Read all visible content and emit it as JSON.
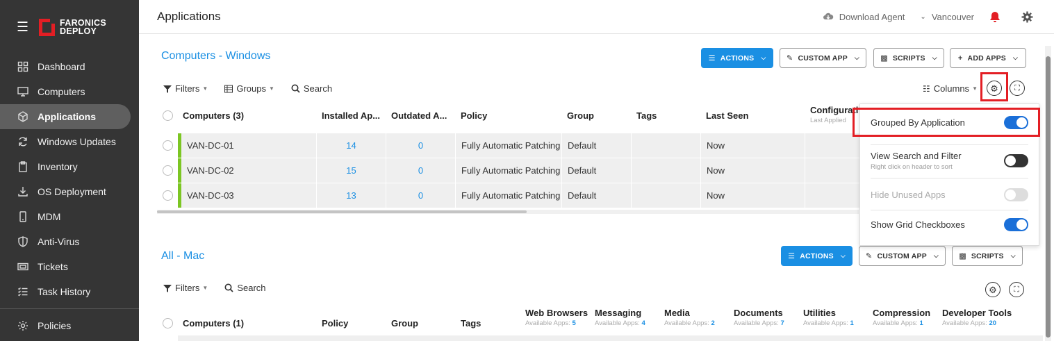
{
  "brand": {
    "line1": "FARONICS",
    "line2": "DEPLOY"
  },
  "nav": [
    {
      "label": "Dashboard",
      "icon": "dashboard-icon"
    },
    {
      "label": "Computers",
      "icon": "monitor-icon"
    },
    {
      "label": "Applications",
      "icon": "cube-icon",
      "active": true
    },
    {
      "label": "Windows Updates",
      "icon": "refresh-icon"
    },
    {
      "label": "Inventory",
      "icon": "clipboard-icon"
    },
    {
      "label": "OS Deployment",
      "icon": "download-icon"
    },
    {
      "label": "MDM",
      "icon": "phone-icon"
    },
    {
      "label": "Anti-Virus",
      "icon": "shield-icon"
    },
    {
      "label": "Tickets",
      "icon": "ticket-icon"
    },
    {
      "label": "Task History",
      "icon": "list-check-icon"
    },
    {
      "label": "Policies",
      "icon": "gear-icon"
    }
  ],
  "topbar": {
    "title": "Applications",
    "download_agent": "Download Agent",
    "location": "Vancouver"
  },
  "windows": {
    "title": "Computers - Windows",
    "actions": "ACTIONS",
    "custom_app": "CUSTOM APP",
    "scripts": "SCRIPTS",
    "add_apps": "ADD APPS",
    "filters": "Filters",
    "groups": "Groups",
    "search": "Search",
    "columns": "Columns",
    "headers": [
      "Computers (3)",
      "Installed Ap...",
      "Outdated A...",
      "Policy",
      "Group",
      "Tags",
      "Last Seen",
      "Configurati"
    ],
    "config_sub": "Last Applied",
    "rows": [
      {
        "name": "VAN-DC-01",
        "installed": "14",
        "outdated": "0",
        "policy": "Fully Automatic Patching",
        "group": "Default",
        "tags": "",
        "last_seen": "Now"
      },
      {
        "name": "VAN-DC-02",
        "installed": "15",
        "outdated": "0",
        "policy": "Fully Automatic Patching",
        "group": "Default",
        "tags": "",
        "last_seen": "Now"
      },
      {
        "name": "VAN-DC-03",
        "installed": "13",
        "outdated": "0",
        "policy": "Fully Automatic Patching",
        "group": "Default",
        "tags": "",
        "last_seen": "Now"
      }
    ]
  },
  "popup": {
    "grouped": "Grouped By Application",
    "view_search": "View Search and Filter",
    "view_search_sub": "Right click on header to sort",
    "hide_unused": "Hide Unused Apps",
    "show_checkboxes": "Show Grid Checkboxes"
  },
  "mac": {
    "title": "All - Mac",
    "actions": "ACTIONS",
    "custom_app": "CUSTOM APP",
    "scripts": "SCRIPTS",
    "filters": "Filters",
    "search": "Search",
    "headers": [
      "Computers (1)",
      "Policy",
      "Group",
      "Tags"
    ],
    "avail_label": "Available Apps:",
    "categories": [
      {
        "name": "Web Browsers",
        "count": "5"
      },
      {
        "name": "Messaging",
        "count": "4"
      },
      {
        "name": "Media",
        "count": "2"
      },
      {
        "name": "Documents",
        "count": "7"
      },
      {
        "name": "Utilities",
        "count": "1"
      },
      {
        "name": "Compression",
        "count": "1"
      },
      {
        "name": "Developer Tools",
        "count": "20"
      }
    ]
  },
  "colors": {
    "accent": "#1a8fe3",
    "brand_red": "#e31e24",
    "status_green": "#7cc623",
    "sidebar": "#353535"
  }
}
